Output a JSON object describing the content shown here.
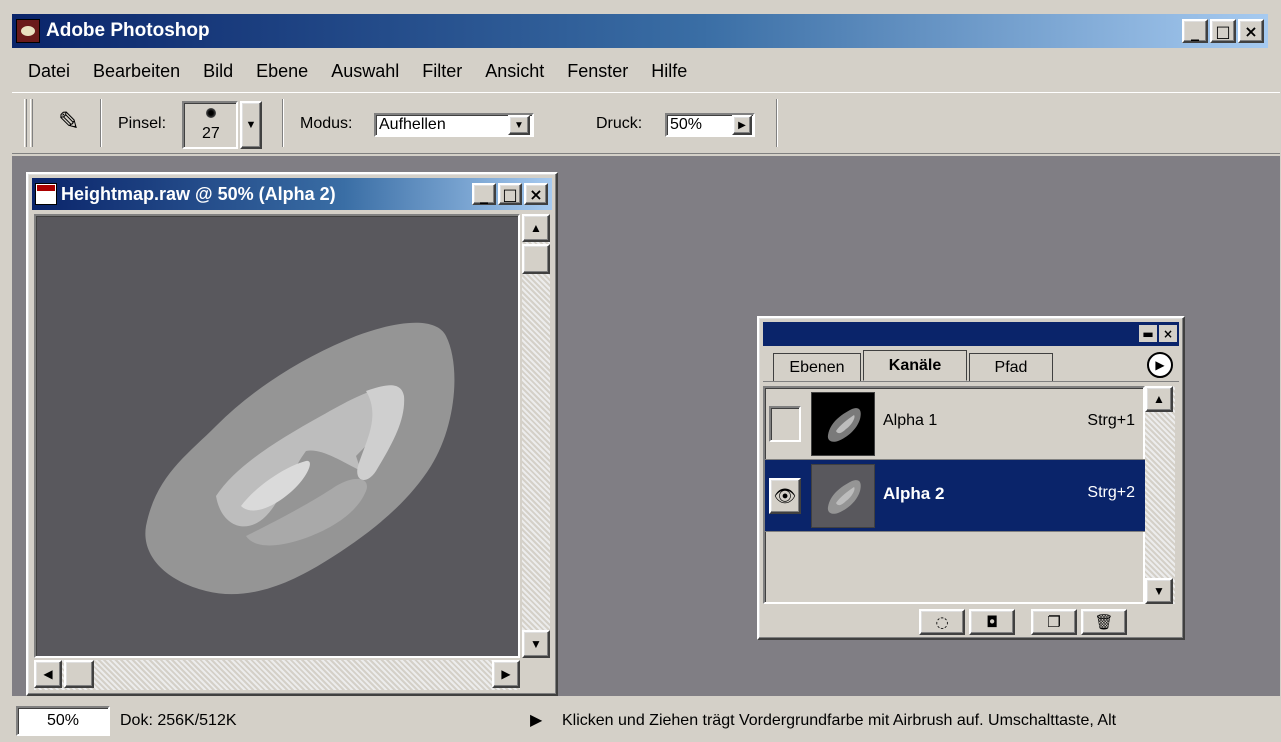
{
  "app": {
    "title": "Adobe Photoshop"
  },
  "window_controls": {
    "minimize": "_",
    "maximize": "□",
    "close": "×"
  },
  "menu": [
    "Datei",
    "Bearbeiten",
    "Bild",
    "Ebene",
    "Auswahl",
    "Filter",
    "Ansicht",
    "Fenster",
    "Hilfe"
  ],
  "options": {
    "brush_label": "Pinsel:",
    "brush_size": "27",
    "mode_label": "Modus:",
    "mode_value": "Aufhellen",
    "pressure_label": "Druck:",
    "pressure_value": "50%"
  },
  "document": {
    "title": "Heightmap.raw @ 50% (Alpha 2)"
  },
  "channels_panel": {
    "tabs": [
      "Ebenen",
      "Kanäle",
      "Pfad"
    ],
    "active_tab": "Kanäle",
    "channels": [
      {
        "name": "Alpha 1",
        "shortcut": "Strg+1",
        "visible": false,
        "selected": false
      },
      {
        "name": "Alpha 2",
        "shortcut": "Strg+2",
        "visible": true,
        "selected": true
      }
    ]
  },
  "status": {
    "zoom": "50%",
    "doc_size": "Dok: 256K/512K",
    "message": "Klicken und Ziehen trägt Vordergrundfarbe mit Airbrush auf. Umschalttaste, Alt"
  }
}
